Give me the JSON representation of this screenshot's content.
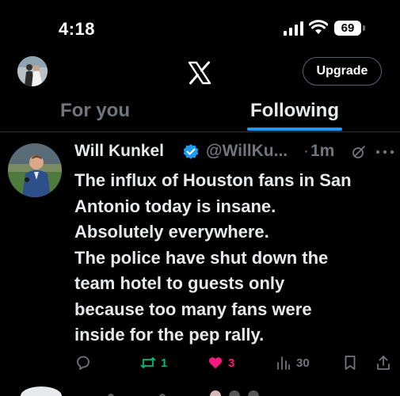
{
  "status_bar": {
    "time": "4:18",
    "battery": "69"
  },
  "header": {
    "logo": "x-logo-icon",
    "upgrade_label": "Upgrade"
  },
  "tabs": [
    {
      "label": "For you",
      "active": false
    },
    {
      "label": "Following",
      "active": true
    }
  ],
  "tweet": {
    "author_name": "Will Kunkel",
    "handle": "@WillKu...",
    "separator": "·",
    "time_ago": "1m",
    "text_lines": [
      "The influx of Houston fans in San",
      "Antonio today is insane.",
      "Absolutely everywhere.",
      "The police have shut down the",
      "team hotel to guests only",
      "because too many fans were",
      "inside for the pep rally."
    ],
    "reposts": "1",
    "likes": "3",
    "views": "30"
  },
  "colors": {
    "accent": "#1d9bf0",
    "repost": "#00ba7c",
    "like": "#f91880",
    "muted": "#71767b"
  }
}
